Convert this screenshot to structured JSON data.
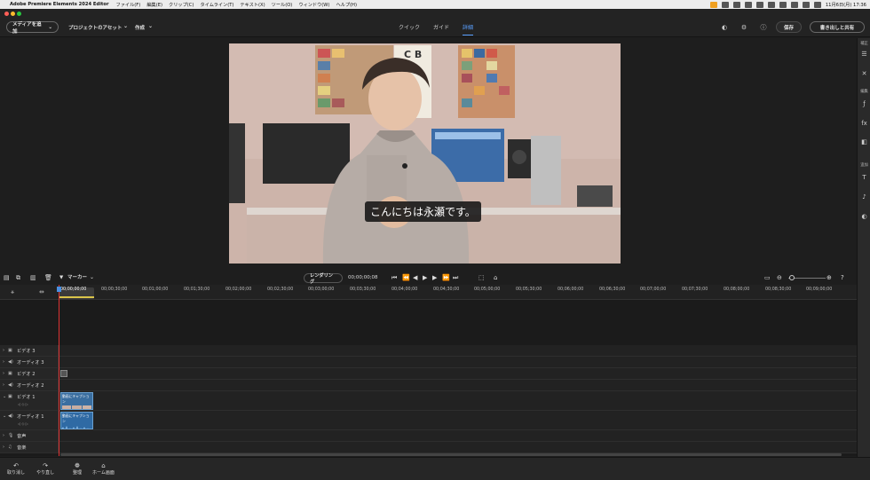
{
  "macmenu": {
    "app_name": "Adobe Premiere Elements 2024 Editor",
    "items": [
      "ファイル(F)",
      "編集(E)",
      "クリップ(C)",
      "タイムライン(T)",
      "テキスト(X)",
      "ツール(O)",
      "ウィンドウ(W)",
      "ヘルプ(H)"
    ],
    "datetime": "11月6日(月)  17:36"
  },
  "topbar": {
    "add_media": "メディアを追加",
    "project_assets": "プロジェクトのアセット",
    "create": "作成",
    "tabs": [
      "クイック",
      "ガイド",
      "詳細"
    ],
    "active_tab": "詳細",
    "save": "保存",
    "export_share": "書き出しと共有"
  },
  "video": {
    "subtitle": "こんにちは永瀬です。"
  },
  "right_panel": {
    "adjust": "補正",
    "edit": "編集",
    "add": "追加"
  },
  "controls": {
    "marker": "マーカー",
    "render": "レンダリング",
    "timecode": "00;00;00;08"
  },
  "ruler": {
    "ticks": [
      "00;00;00;00",
      "00;00;30;00",
      "00;01;00;00",
      "00;01;30;00",
      "00;02;00;00",
      "00;02;30;00",
      "00;03;00;00",
      "00;03;30;00",
      "00;04;00;00",
      "00;04;30;00",
      "00;05;00;00",
      "00;05;30;00",
      "00;06;00;00",
      "00;06;30;00",
      "00;07;00;00",
      "00;07;30;00",
      "00;08;00;00",
      "00;08;30;00",
      "00;09;00;00"
    ]
  },
  "tracks": {
    "video3": "ビデオ 3",
    "audio3": "オーディオ 3",
    "video2": "ビデオ 2",
    "audio2": "オーディオ 2",
    "video1": "ビデオ 1",
    "audio1": "オーディオ 1",
    "voice": "音声",
    "music": "音楽",
    "clip_label": "動画にキャプション"
  },
  "bottom": {
    "undo": "取り消し",
    "redo": "やり直し",
    "organize": "整理",
    "home": "ホーム画面"
  }
}
